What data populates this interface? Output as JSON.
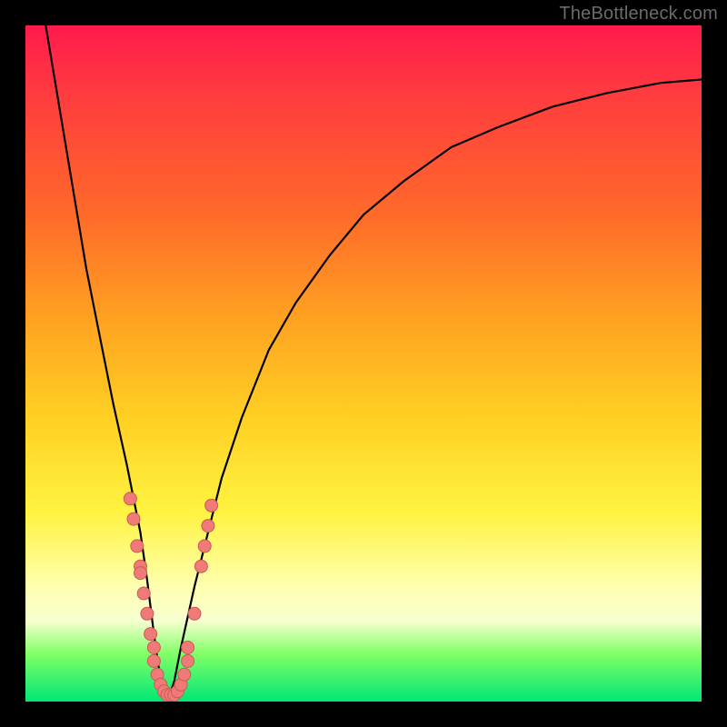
{
  "watermark": "TheBottleneck.com",
  "colors": {
    "curve": "#000000",
    "dots_fill": "#ef7a77",
    "dots_stroke": "#c95b58"
  },
  "chart_data": {
    "type": "line",
    "title": "",
    "xlabel": "",
    "ylabel": "",
    "xlim": [
      0,
      100
    ],
    "ylim": [
      0,
      100
    ],
    "series": [
      {
        "name": "bottleneck-curve",
        "x": [
          3,
          5,
          7,
          9,
          11,
          13,
          15,
          17,
          18,
          19,
          20,
          21,
          22,
          23,
          25,
          27,
          29,
          32,
          36,
          40,
          45,
          50,
          56,
          63,
          70,
          78,
          86,
          94,
          100
        ],
        "y": [
          100,
          88,
          76,
          64,
          54,
          44,
          35,
          25,
          18,
          10,
          3,
          0,
          3,
          8,
          17,
          25,
          33,
          42,
          52,
          59,
          66,
          72,
          77,
          82,
          85,
          88,
          90,
          91.5,
          92
        ]
      }
    ],
    "dots": [
      {
        "x": 15.5,
        "y": 30
      },
      {
        "x": 16.0,
        "y": 27
      },
      {
        "x": 16.5,
        "y": 23
      },
      {
        "x": 17.0,
        "y": 20
      },
      {
        "x": 17.0,
        "y": 19
      },
      {
        "x": 17.5,
        "y": 16
      },
      {
        "x": 18.0,
        "y": 13
      },
      {
        "x": 18.5,
        "y": 10
      },
      {
        "x": 19.0,
        "y": 8
      },
      {
        "x": 19.0,
        "y": 6
      },
      {
        "x": 19.5,
        "y": 4
      },
      {
        "x": 20.0,
        "y": 2.5
      },
      {
        "x": 20.5,
        "y": 1.5
      },
      {
        "x": 21.0,
        "y": 1
      },
      {
        "x": 21.5,
        "y": 1
      },
      {
        "x": 22.0,
        "y": 1
      },
      {
        "x": 22.5,
        "y": 1.5
      },
      {
        "x": 23.0,
        "y": 2.5
      },
      {
        "x": 23.5,
        "y": 4
      },
      {
        "x": 24.0,
        "y": 6
      },
      {
        "x": 24.0,
        "y": 8
      },
      {
        "x": 25.0,
        "y": 13
      },
      {
        "x": 26.0,
        "y": 20
      },
      {
        "x": 26.5,
        "y": 23
      },
      {
        "x": 27.0,
        "y": 26
      },
      {
        "x": 27.5,
        "y": 29
      }
    ]
  }
}
